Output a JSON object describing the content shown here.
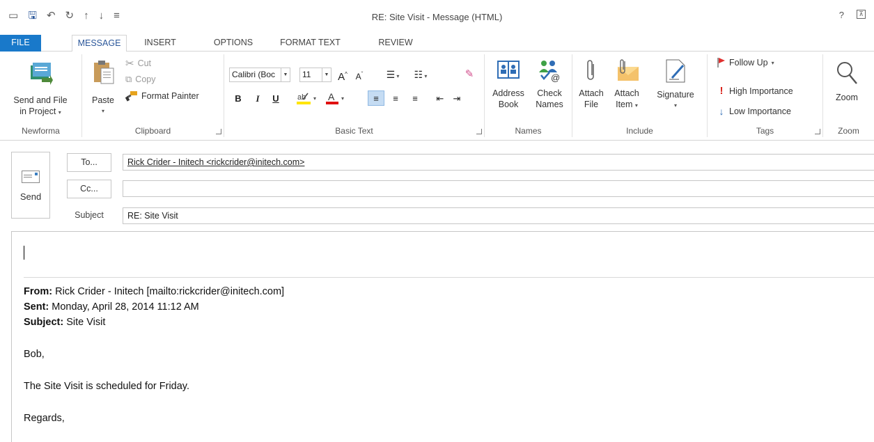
{
  "window": {
    "title": "RE: Site  Visit - Message (HTML)",
    "help": "?",
    "restore": "⊼"
  },
  "qat": {
    "icons": [
      "mail-icon",
      "save-icon",
      "undo-icon",
      "redo-icon",
      "up-arrow-icon",
      "down-arrow-icon",
      "customize-icon"
    ],
    "glyphs": [
      "▭",
      "🖫",
      "↶",
      "↻",
      "↑",
      "↓",
      "≡"
    ]
  },
  "tabs": [
    "FILE",
    "MESSAGE",
    "INSERT",
    "OPTIONS",
    "FORMAT TEXT",
    "REVIEW"
  ],
  "ribbon": {
    "newforma": {
      "btn_line1": "Send and File",
      "btn_line2": "in Project",
      "label": "Newforma"
    },
    "clipboard": {
      "paste": "Paste",
      "cut": "Cut",
      "copy": "Copy",
      "format_painter": "Format Painter",
      "label": "Clipboard"
    },
    "basic_text": {
      "font": "Calibri (Boc",
      "size": "11",
      "bold": "B",
      "italic": "I",
      "underline": "U",
      "grow": "A",
      "shrink": "A",
      "label": "Basic Text"
    },
    "names": {
      "address_1": "Address",
      "address_2": "Book",
      "check_1": "Check",
      "check_2": "Names",
      "label": "Names"
    },
    "include": {
      "attach_file_1": "Attach",
      "attach_file_2": "File",
      "attach_item_1": "Attach",
      "attach_item_2": "Item",
      "signature": "Signature",
      "label": "Include"
    },
    "tags": {
      "follow_up": "Follow Up",
      "high": "High Importance",
      "low": "Low Importance",
      "label": "Tags"
    },
    "zoom": {
      "btn": "Zoom",
      "label": "Zoom"
    }
  },
  "header": {
    "send": "Send",
    "to_btn": "To...",
    "cc_btn": "Cc...",
    "subject_label": "Subject",
    "to_value": "Rick Crider - Initech <rickcrider@initech.com>",
    "cc_value": "",
    "subject_value": "RE: Site  Visit"
  },
  "body": {
    "from_label": "From:",
    "from_value": " Rick Crider - Initech [mailto:rickcrider@initech.com]",
    "sent_label": "Sent:",
    "sent_value": " Monday, April 28, 2014 11:12 AM",
    "subject_label": "Subject:",
    "subject_value": " Site Visit",
    "greeting": "Bob,",
    "line1": "The Site Visit is scheduled for Friday.",
    "closing": "Regards,"
  },
  "colors": {
    "file_tab": "#1979ca",
    "active_tab_text": "#2b579a",
    "follow_up_flag": "#e0302f",
    "high_importance": "#d9241c",
    "low_importance": "#2f6db5",
    "highlight_yellow": "#ffe500",
    "font_color_red": "#e01010"
  }
}
